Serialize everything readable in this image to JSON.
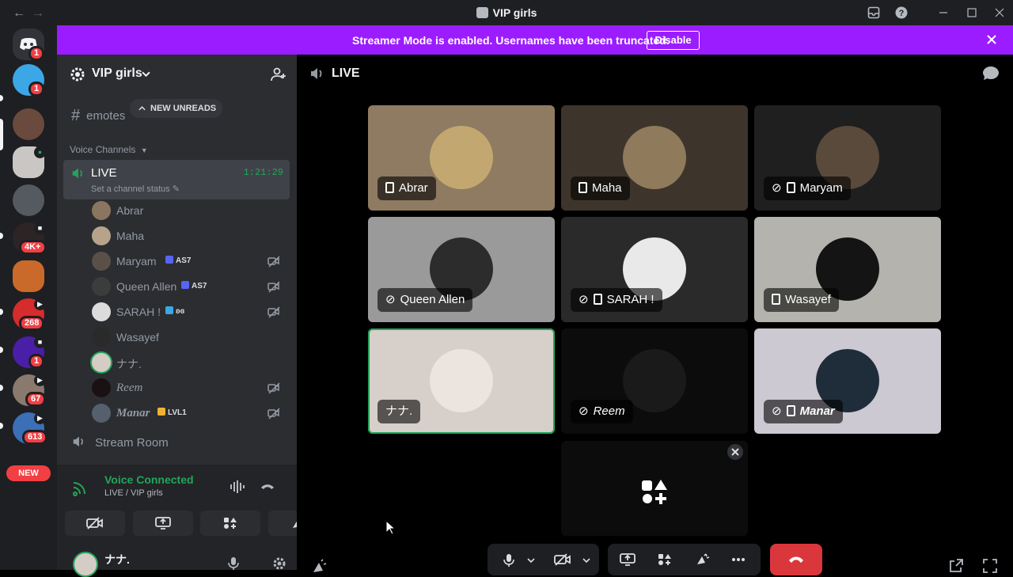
{
  "titlebar": {
    "title": "VIP girls"
  },
  "banner": {
    "message": "Streamer Mode is enabled. Usernames have been truncated.",
    "button": "Disable"
  },
  "guilds": {
    "badges": [
      "1",
      "1",
      "4K+",
      "268",
      "1",
      "67",
      "613"
    ],
    "new_pill": "NEW"
  },
  "sidebar": {
    "server_name": "VIP girls",
    "text_channel": "emotes",
    "new_unreads": "NEW UNREADS",
    "category": "Voice Channels",
    "live_channel": {
      "name": "LIVE",
      "timer": "1:21:29",
      "status": "Set a channel status"
    },
    "members": [
      {
        "name": "Abrar",
        "tag": ""
      },
      {
        "name": "Maha",
        "tag": ""
      },
      {
        "name": "Maryam",
        "tag": "AS7"
      },
      {
        "name": "Queen Allen",
        "tag": "AS7"
      },
      {
        "name": "SARAH !",
        "tag": "ʚɞ"
      },
      {
        "name": "Wasayef",
        "tag": ""
      },
      {
        "name": "ナナ.",
        "tag": ""
      },
      {
        "name": "Reem",
        "tag": ""
      },
      {
        "name": "Manar",
        "tag": "LVL1"
      }
    ],
    "stream_room": "Stream Room",
    "voice_panel": {
      "status": "Voice Connected",
      "subtitle": "LIVE / VIP girls"
    },
    "user": {
      "name": "ナナ."
    }
  },
  "main": {
    "channel_title": "LIVE",
    "tiles": [
      {
        "name": "Abrar"
      },
      {
        "name": "Maha"
      },
      {
        "name": "Maryam"
      },
      {
        "name": "Queen Allen"
      },
      {
        "name": "SARAH !"
      },
      {
        "name": "Wasayef"
      },
      {
        "name": "ナナ."
      },
      {
        "name": "Reem"
      },
      {
        "name": "Manar"
      }
    ]
  },
  "colors": {
    "accent": "#9b1dff",
    "connected": "#23a55a",
    "danger": "#da373c"
  }
}
